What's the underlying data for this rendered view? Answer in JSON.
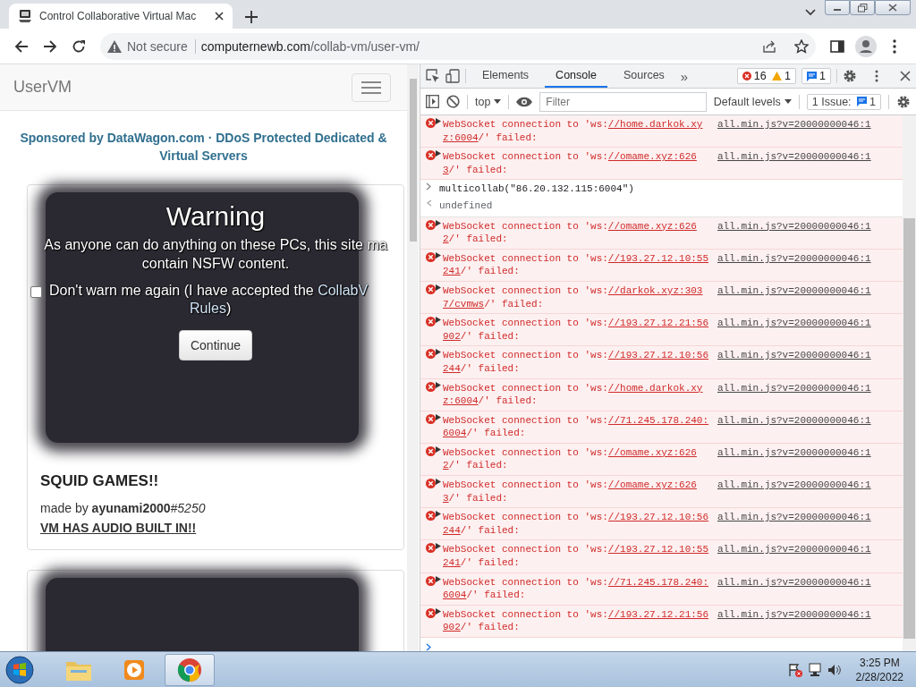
{
  "browser": {
    "tab": {
      "title": "Control Collaborative Virtual Mac",
      "selected": true
    },
    "address": {
      "security": "Not secure",
      "host": "computernewb.com",
      "path": "/collab-vm/user-vm/"
    }
  },
  "page": {
    "brand": "UserVM",
    "sponsor": "Sponsored by DataWagon.com · DDoS Protected Dedicated & Virtual Servers",
    "warning": {
      "title": "Warning",
      "lines": [
        "As anyone can do anything on these PCs, this site ma",
        "contain NSFW content."
      ],
      "checkbox": {
        "checked": false,
        "label": "Don't warn me again (I have accepted the ",
        "link_1": "CollabV",
        "link_2": "Rules",
        "label_end": ")"
      },
      "button": "Continue"
    },
    "vm": {
      "title": "SQUID GAMES!!",
      "made_by": "made by **ayunami2000**",
      "tag": "#5250",
      "note": "VM HAS AUDIO BUILT IN!!"
    }
  },
  "devtools": {
    "tabs": [
      {
        "label": "Elements",
        "selected": false
      },
      {
        "label": "Console",
        "selected": true
      },
      {
        "label": "Sources",
        "selected": false
      }
    ],
    "more": "»",
    "error_count": "16",
    "warning_count": "1",
    "message_count": "1",
    "context": "top",
    "filter_placeholder": "Filter",
    "levels": "Default levels",
    "issues_label": "1 Issue:",
    "issues_count": "1",
    "console": [
      {
        "kind": "error",
        "text": "WebSocket connection to 'ws:",
        "url_1": "//home.darkok.xy",
        "url_2": "z:6004",
        "end": "/' failed:",
        "source": "all.min.js?v=20000000046:1"
      },
      {
        "kind": "error",
        "text": "WebSocket connection to 'ws:",
        "url_1": "//omame.xyz:626",
        "url_2": "3",
        "end": "/' failed:",
        "source": "all.min.js?v=20000000046:1"
      },
      {
        "kind": "input",
        "text": "multicollab(\"86.20.132.115:6004\")"
      },
      {
        "kind": "result",
        "text": "undefined"
      },
      {
        "kind": "error",
        "text": "WebSocket connection to 'ws:",
        "url_1": "//omame.xyz:626",
        "url_2": "2",
        "end": "/' failed:",
        "source": "all.min.js?v=20000000046:1"
      },
      {
        "kind": "error",
        "text": "WebSocket connection to 'ws:",
        "url_1": "//193.27.12.10:55",
        "url_2": "241",
        "end": "/' failed:",
        "source": "all.min.js?v=20000000046:1"
      },
      {
        "kind": "error",
        "text": "WebSocket connection to 'ws:",
        "url_1": "//darkok.xyz:303",
        "url_2": "7/cvmws",
        "end": "/' failed:",
        "source": "all.min.js?v=20000000046:1"
      },
      {
        "kind": "error",
        "text": "WebSocket connection to 'ws:",
        "url_1": "//193.27.12.21:56",
        "url_2": "902",
        "end": "/' failed:",
        "source": "all.min.js?v=20000000046:1"
      },
      {
        "kind": "error",
        "text": "WebSocket connection to 'ws:",
        "url_1": "//193.27.12.10:56",
        "url_2": "244",
        "end": "/' failed:",
        "source": "all.min.js?v=20000000046:1"
      },
      {
        "kind": "error",
        "text": "WebSocket connection to 'ws:",
        "url_1": "//home.darkok.xy",
        "url_2": "z:6004",
        "end": "/' failed:",
        "source": "all.min.js?v=20000000046:1"
      },
      {
        "kind": "error",
        "text": "WebSocket connection to 'ws:",
        "url_1": "//71.245.178.240:",
        "url_2": "6004",
        "end": "/' failed:",
        "source": "all.min.js?v=20000000046:1"
      },
      {
        "kind": "error",
        "text": "WebSocket connection to 'ws:",
        "url_1": "//omame.xyz:626",
        "url_2": "2",
        "end": "/' failed:",
        "source": "all.min.js?v=20000000046:1"
      },
      {
        "kind": "error",
        "text": "WebSocket connection to 'ws:",
        "url_1": "//omame.xyz:626",
        "url_2": "3",
        "end": "/' failed:",
        "source": "all.min.js?v=20000000046:1"
      },
      {
        "kind": "error",
        "text": "WebSocket connection to 'ws:",
        "url_1": "//193.27.12.10:56",
        "url_2": "244",
        "end": "/' failed:",
        "source": "all.min.js?v=20000000046:1"
      },
      {
        "kind": "error",
        "text": "WebSocket connection to 'ws:",
        "url_1": "//193.27.12.10:55",
        "url_2": "241",
        "end": "/' failed:",
        "source": "all.min.js?v=20000000046:1"
      },
      {
        "kind": "error",
        "text": "WebSocket connection to 'ws:",
        "url_1": "//71.245.178.240:",
        "url_2": "6004",
        "end": "/' failed:",
        "source": "all.min.js?v=20000000046:1"
      },
      {
        "kind": "error",
        "text": "WebSocket connection to 'ws:",
        "url_1": "//193.27.12.21:56",
        "url_2": "902",
        "end": "/' failed:",
        "source": "all.min.js?v=20000000046:1"
      }
    ]
  },
  "taskbar": {
    "apps": [
      {
        "kind": "explorer",
        "selected": false
      },
      {
        "kind": "media",
        "selected": false
      },
      {
        "kind": "chrome",
        "selected": true
      }
    ],
    "time": "3:25 PM",
    "date": "2/28/2022"
  }
}
